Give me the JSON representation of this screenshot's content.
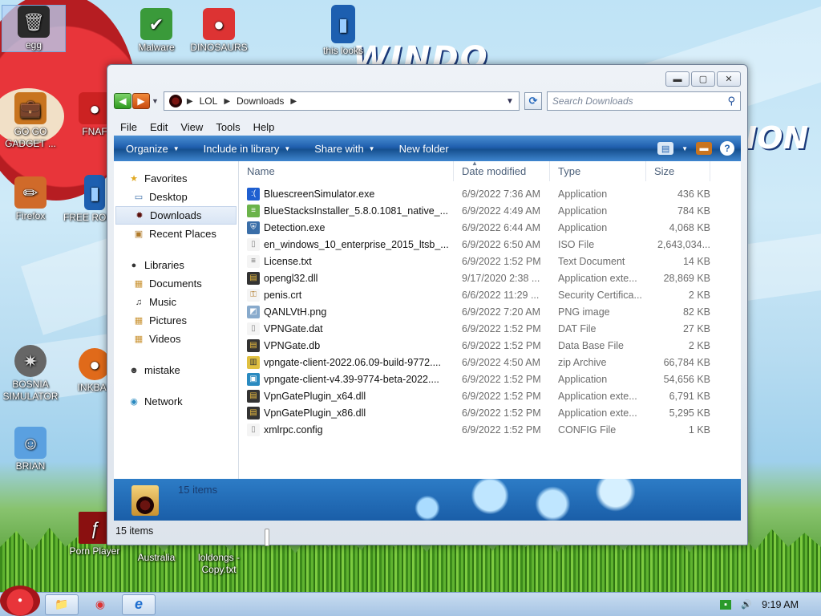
{
  "desktop": {
    "logo_text": "WINDO",
    "logo_text2": "ION",
    "icons": [
      {
        "id": "egg",
        "label": "egg",
        "glyph": "🗑",
        "bg": "#2a2a2a"
      },
      {
        "id": "malware",
        "label": "Malware",
        "glyph": "✔",
        "bg": "#3a9a3a"
      },
      {
        "id": "dinosaurs",
        "label": "DINOSAURS",
        "glyph": "●",
        "bg": "#d33"
      },
      {
        "id": "thislooks",
        "label": "this looks",
        "glyph": "▮",
        "bg": "#1d5fb0"
      },
      {
        "id": "gogogadget",
        "label": "GO GO GADGET ...",
        "glyph": "💼",
        "bg": "#c8741f"
      },
      {
        "id": "fnaf",
        "label": "FNAF",
        "glyph": "●",
        "bg": "#c22"
      },
      {
        "id": "firefox",
        "label": "Firefox",
        "glyph": "✏",
        "bg": "#d06a2a"
      },
      {
        "id": "freerobux",
        "label": "FREE ROBUX",
        "glyph": "▮",
        "bg": "#1d5fb0"
      },
      {
        "id": "bosnia",
        "label": "BOSNIA SIMULATOR",
        "glyph": "✷",
        "bg": "#666"
      },
      {
        "id": "inkball",
        "label": "INKBAL",
        "glyph": "●",
        "bg": "#e06a1a"
      },
      {
        "id": "brian",
        "label": "BRIAN",
        "glyph": "☺",
        "bg": "#5aa0e0"
      },
      {
        "id": "pornplayer",
        "label": "Porn Player",
        "glyph": "ƒ",
        "bg": "#8a1010"
      },
      {
        "id": "australia",
        "label": "Australia",
        "glyph": "",
        "bg": "transparent"
      },
      {
        "id": "loldongs",
        "label": "loldongs - Copy.txt",
        "glyph": "",
        "bg": "transparent"
      }
    ]
  },
  "window": {
    "controls": {
      "minimize": "▬",
      "maximize": "▢",
      "close": "✕"
    },
    "address": {
      "crumbs": [
        "LOL",
        "Downloads"
      ]
    },
    "search_placeholder": "Search Downloads",
    "menu": [
      "File",
      "Edit",
      "View",
      "Tools",
      "Help"
    ],
    "commands": [
      {
        "label": "Organize",
        "dropdown": true
      },
      {
        "label": "Include in library",
        "dropdown": true
      },
      {
        "label": "Share with",
        "dropdown": true
      },
      {
        "label": "New folder",
        "dropdown": false
      }
    ],
    "nav": {
      "favorites": {
        "label": "Favorites",
        "items": [
          "Desktop",
          "Downloads",
          "Recent Places"
        ]
      },
      "libraries": {
        "label": "Libraries",
        "items": [
          "Documents",
          "Music",
          "Pictures",
          "Videos"
        ]
      },
      "mistake": "mistake",
      "network": "Network"
    },
    "columns": {
      "name": "Name",
      "date": "Date modified",
      "type": "Type",
      "size": "Size"
    },
    "files": [
      {
        "name": "BluescreenSimulator.exe",
        "date": "6/9/2022 7:36 AM",
        "type": "Application",
        "size": "436 KB",
        "icon": "bsod"
      },
      {
        "name": "BlueStacksInstaller_5.8.0.1081_native_...",
        "date": "6/9/2022 4:49 AM",
        "type": "Application",
        "size": "784 KB",
        "icon": "stack"
      },
      {
        "name": "Detection.exe",
        "date": "6/9/2022 6:44 AM",
        "type": "Application",
        "size": "4,068 KB",
        "icon": "shield"
      },
      {
        "name": "en_windows_10_enterprise_2015_ltsb_...",
        "date": "6/9/2022 6:50 AM",
        "type": "ISO File",
        "size": "2,643,034...",
        "icon": "doc"
      },
      {
        "name": "License.txt",
        "date": "6/9/2022 1:52 PM",
        "type": "Text Document",
        "size": "14 KB",
        "icon": "txt"
      },
      {
        "name": "opengl32.dll",
        "date": "9/17/2020 2:38 ...",
        "type": "Application exte...",
        "size": "28,869 KB",
        "icon": "dll"
      },
      {
        "name": "penis.crt",
        "date": "6/6/2022 11:29 ...",
        "type": "Security Certifica...",
        "size": "2 KB",
        "icon": "crt"
      },
      {
        "name": "QANLVtH.png",
        "date": "6/9/2022 7:20 AM",
        "type": "PNG image",
        "size": "82 KB",
        "icon": "png"
      },
      {
        "name": "VPNGate.dat",
        "date": "6/9/2022 1:52 PM",
        "type": "DAT File",
        "size": "27 KB",
        "icon": "doc"
      },
      {
        "name": "VPNGate.db",
        "date": "6/9/2022 1:52 PM",
        "type": "Data Base File",
        "size": "2 KB",
        "icon": "dll"
      },
      {
        "name": "vpngate-client-2022.06.09-build-9772....",
        "date": "6/9/2022 4:50 AM",
        "type": "zip Archive",
        "size": "66,784 KB",
        "icon": "zip"
      },
      {
        "name": "vpngate-client-v4.39-9774-beta-2022....",
        "date": "6/9/2022 1:52 PM",
        "type": "Application",
        "size": "54,656 KB",
        "icon": "app"
      },
      {
        "name": "VpnGatePlugin_x64.dll",
        "date": "6/9/2022 1:52 PM",
        "type": "Application exte...",
        "size": "6,791 KB",
        "icon": "dll"
      },
      {
        "name": "VpnGatePlugin_x86.dll",
        "date": "6/9/2022 1:52 PM",
        "type": "Application exte...",
        "size": "5,295 KB",
        "icon": "dll"
      },
      {
        "name": "xmlrpc.config",
        "date": "6/9/2022 1:52 PM",
        "type": "CONFIG File",
        "size": "1 KB",
        "icon": "doc"
      }
    ],
    "details_text": "15 items",
    "status_text": "15 items"
  },
  "taskbar": {
    "clock": "9:19 AM",
    "apps": [
      {
        "id": "explorer",
        "glyph": "📁",
        "active": true
      },
      {
        "id": "chrome",
        "glyph": "◉",
        "active": false
      },
      {
        "id": "ie",
        "glyph": "e",
        "active": true
      }
    ]
  }
}
